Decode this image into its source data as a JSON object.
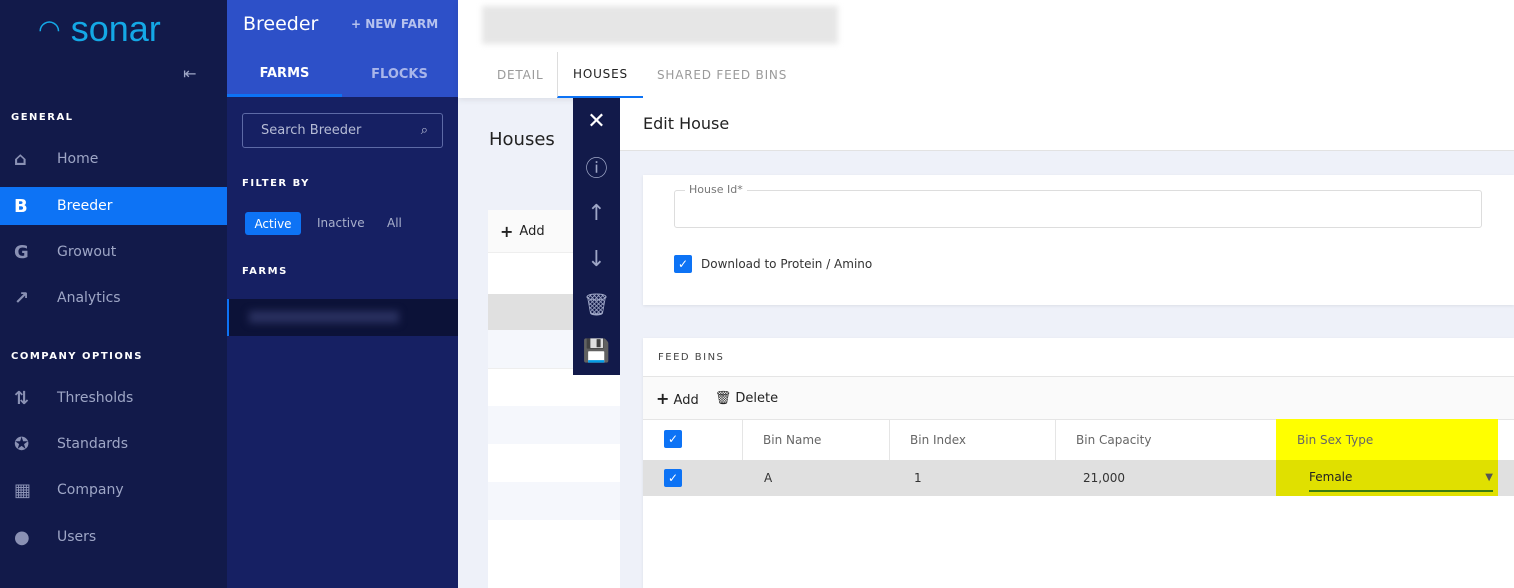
{
  "sidebar": {
    "logo": "sonar",
    "collapse_icon": "collapse-left-icon",
    "general_label": "GENERAL",
    "company_label": "COMPANY OPTIONS",
    "items": [
      {
        "icon": "H",
        "label": "Home"
      },
      {
        "icon": "B",
        "label": "Breeder"
      },
      {
        "icon": "G",
        "label": "Growout"
      },
      {
        "icon": "~",
        "label": "Analytics"
      },
      {
        "icon": "⇅",
        "label": "Thresholds"
      },
      {
        "icon": "✪",
        "label": "Standards"
      },
      {
        "icon": "▦",
        "label": "Company"
      },
      {
        "icon": "●",
        "label": "Users"
      }
    ]
  },
  "breeder": {
    "title": "Breeder",
    "new_farm": "+ NEW FARM",
    "tabs": [
      "FARMS",
      "FLOCKS"
    ],
    "search_placeholder": "Search Breeder",
    "filter_label": "FILTER BY",
    "filters": [
      "Active",
      "Inactive",
      "All"
    ],
    "farms_label": "FARMS"
  },
  "main": {
    "tabs": [
      "DETAIL",
      "HOUSES",
      "SHARED FEED BINS"
    ],
    "houses_title": "Houses",
    "add": "Add"
  },
  "edit": {
    "title": "Edit House",
    "house_id_label": "House Id*",
    "download_label": "Download to Protein / Amino",
    "download_checked": true,
    "feed_bins_label": "FEED BINS",
    "add": "Add",
    "delete": "Delete",
    "columns": [
      "Bin Name",
      "Bin Index",
      "Bin Capacity",
      "Bin Sex Type"
    ],
    "rows": [
      {
        "name": "A",
        "index": "1",
        "capacity": "21,000",
        "sex": "Female"
      }
    ]
  },
  "colors": {
    "accent": "#0d73f5",
    "sidebar": "#121a4a",
    "highlight": "#ffff00"
  }
}
